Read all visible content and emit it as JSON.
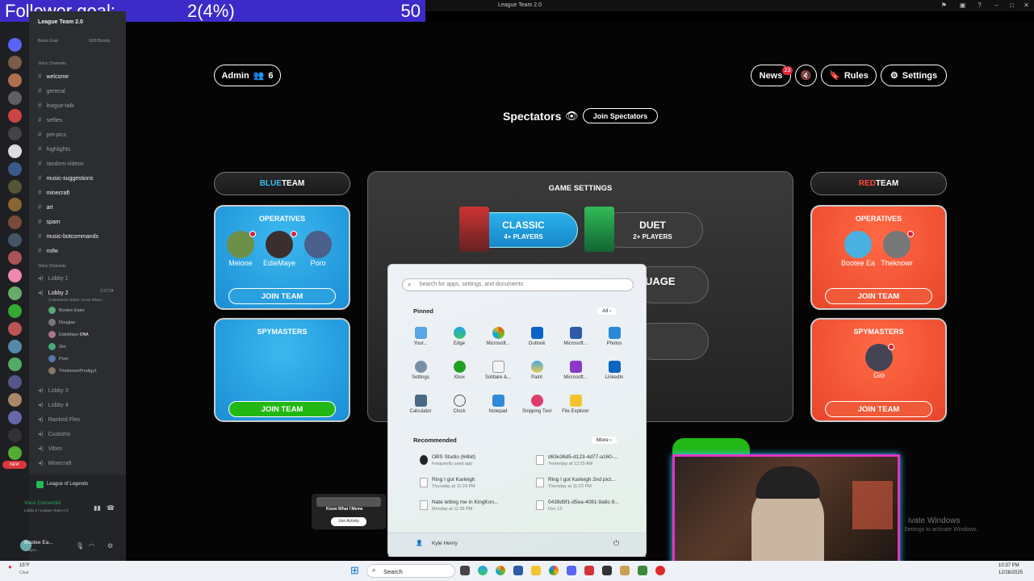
{
  "follower_bar": {
    "label": "Follower goal:",
    "current": "2(4%)",
    "goal": "50"
  },
  "browser": {
    "tab_title": "League Team 2.0"
  },
  "discord": {
    "server_name": "League Team 2.0",
    "boost_goal": "Boost Goal",
    "boosts": "0/28 Boosts",
    "text_header": "Text Channels",
    "text_channels": [
      "welcome",
      "general",
      "league-talk",
      "selfies",
      "pet-pics",
      "highlights",
      "random-videos",
      "music-suggestions",
      "minecraft",
      "art",
      "spam",
      "music-botcommands",
      "nsfw"
    ],
    "voice_header": "Voice Channels",
    "lobby1": "Lobby 1",
    "lobby2": "Lobby 2",
    "lobby2_time": "2:37:24",
    "lobby2_status": "Codenames Online, Know What I...",
    "voice_users": [
      "Bootee Eater",
      "Douglas",
      "EdieMaye",
      "Gio",
      "Poro",
      "TheknownProdigy1"
    ],
    "dna_tag": "DNA",
    "other_voice": [
      "Lobby 3",
      "Lobby 4",
      "Ranked Flex",
      "Customs",
      "Vibes",
      "Minecraft"
    ],
    "new_badge": "NEW",
    "current_activity": "League of Legends",
    "voice_connected": "Voice Connected",
    "voice_location": "Lobby 2 / League Team 2.0",
    "user_name": "Bootee Ea...",
    "user_status": "League..."
  },
  "game": {
    "admin_label": "Admin",
    "player_count": "6",
    "news_label": "News",
    "news_badge": "23",
    "rules_label": "Rules",
    "settings_label": "Settings",
    "spectators_label": "Spectators",
    "join_spectators": "Join Spectators",
    "blue_team_a": "BLUE",
    "blue_team_b": " TEAM",
    "red_team_a": "RED",
    "red_team_b": " TEAM",
    "operatives": "OPERATIVES",
    "spymasters": "SPYMASTERS",
    "join_team": "JOIN TEAM",
    "blue_operatives": [
      "Meione",
      "EdieMaye",
      "Poro"
    ],
    "red_operatives": [
      "Bootee Ea",
      "Theknowr"
    ],
    "red_spymasters": [
      "Gio"
    ],
    "game_settings": "GAME SETTINGS",
    "classic": "CLASSIC",
    "classic_players": "4+ PLAYERS",
    "duet": "DUET",
    "duet_players": "2+ PLAYERS",
    "language_partial": "UAGE"
  },
  "start_menu": {
    "search_placeholder": "Search for apps, settings, and documents",
    "pinned_label": "Pinned",
    "all_label": "All",
    "pinned": [
      "Your...",
      "Edge",
      "Microsoft...",
      "Outlook",
      "Microsoft...",
      "Photos",
      "Settings",
      "Xbox",
      "Solitaire &...",
      "Paint",
      "Microsoft...",
      "LinkedIn",
      "Calculator",
      "Clock",
      "Notepad",
      "Snipping Tool",
      "File Explorer"
    ],
    "recommended_label": "Recommended",
    "more_label": "More",
    "recommended": [
      {
        "name": "OBS Studio (64bit)",
        "sub": "Frequently used app"
      },
      {
        "name": "d63e36d5-d123-4d77-a160-...",
        "sub": "Yesterday at 12:29 AM"
      },
      {
        "name": "Ring I got Karleigh",
        "sub": "Thursday at 11:24 PM"
      },
      {
        "name": "Ring I got Karleigh 2nd pict...",
        "sub": "Thursday at 11:23 PM"
      },
      {
        "name": "Nate letting me in KingKon...",
        "sub": "Monday at 11:35 PM"
      },
      {
        "name": "0438d9f1-d5ea-4081-9a8c-9...",
        "sub": "Dec 13"
      }
    ],
    "user": "Kyle Henry"
  },
  "activity": {
    "title": "Know What I Meme",
    "button": "Join Activity"
  },
  "watermark": {
    "line1": "ivate Windows",
    "line2": "Settings to activate Windows."
  },
  "taskbar": {
    "weather_temp": "15°F",
    "weather_desc": "Clear",
    "search": "Search",
    "time": "10:37 PM",
    "date": "12/28/2025"
  },
  "colors": {
    "blue_panel": "#1a8ed6",
    "red_panel": "#e8452a",
    "join_green": "#22b814",
    "follower_bar": "#3c2bc8"
  }
}
